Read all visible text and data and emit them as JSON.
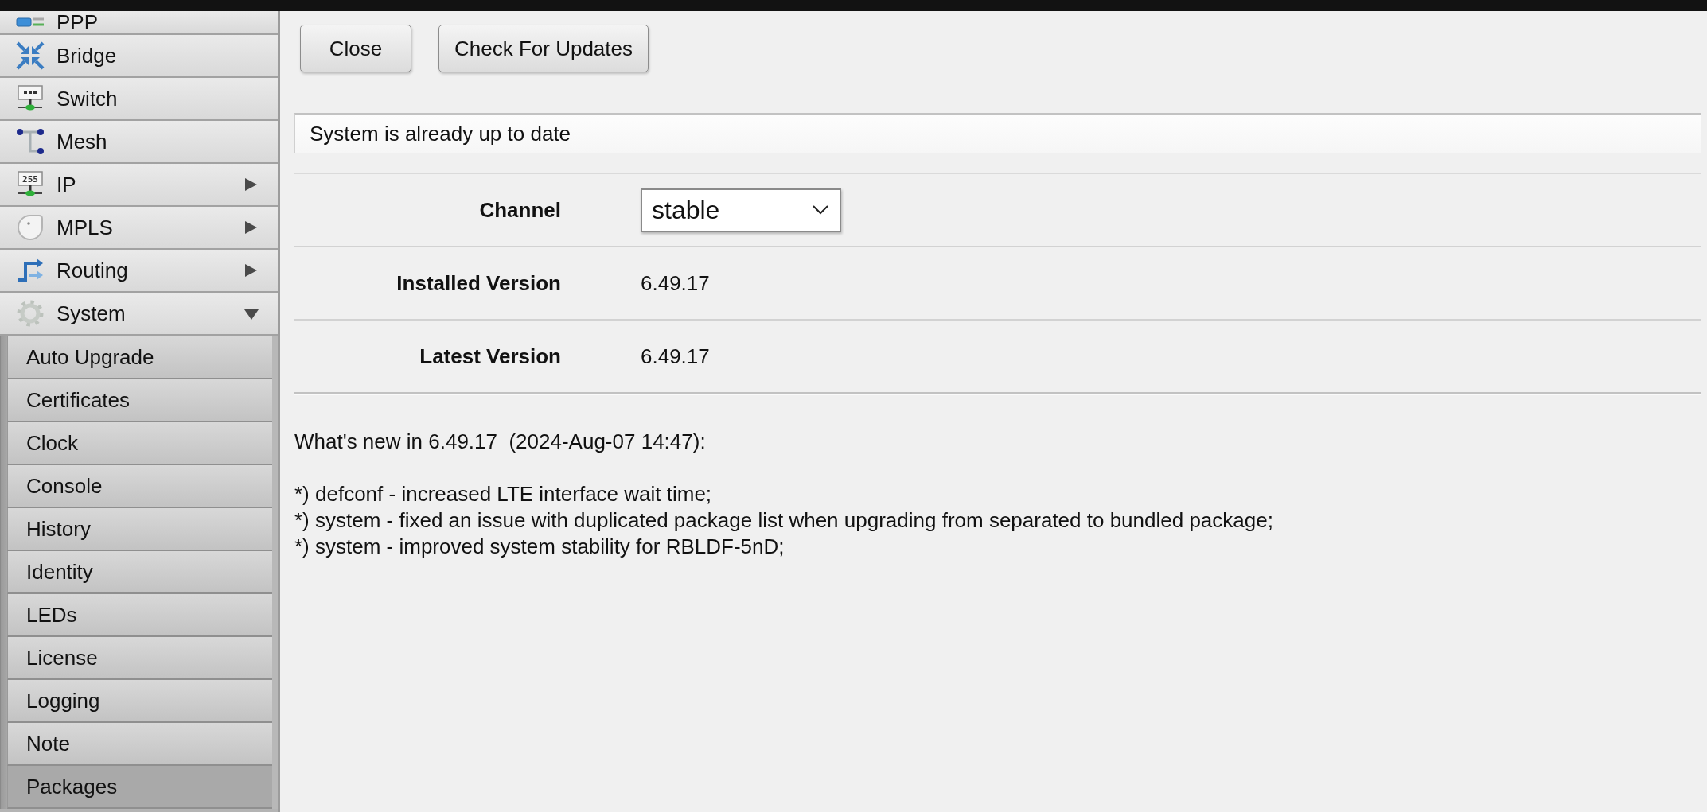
{
  "sidebar": {
    "items": [
      {
        "label": "PPP",
        "kind": "leaf"
      },
      {
        "label": "Bridge",
        "kind": "leaf"
      },
      {
        "label": "Switch",
        "kind": "leaf"
      },
      {
        "label": "Mesh",
        "kind": "leaf"
      },
      {
        "label": "IP",
        "kind": "folder",
        "expanded": false,
        "icon_text": "255"
      },
      {
        "label": "MPLS",
        "kind": "folder",
        "expanded": false
      },
      {
        "label": "Routing",
        "kind": "folder",
        "expanded": false
      },
      {
        "label": "System",
        "kind": "folder",
        "expanded": true,
        "children": [
          {
            "label": "Auto Upgrade",
            "selected": false
          },
          {
            "label": "Certificates",
            "selected": false
          },
          {
            "label": "Clock",
            "selected": false
          },
          {
            "label": "Console",
            "selected": false
          },
          {
            "label": "History",
            "selected": false
          },
          {
            "label": "Identity",
            "selected": false
          },
          {
            "label": "LEDs",
            "selected": false
          },
          {
            "label": "License",
            "selected": false
          },
          {
            "label": "Logging",
            "selected": false
          },
          {
            "label": "Note",
            "selected": false
          },
          {
            "label": "Packages",
            "selected": true
          }
        ]
      }
    ]
  },
  "toolbar": {
    "buttons": [
      "Close",
      "Check For Updates"
    ]
  },
  "status_message": "System is already up to date",
  "fields": [
    {
      "label": "Channel",
      "kind": "select",
      "value": "stable"
    },
    {
      "label": "Installed Version",
      "kind": "text",
      "value": "6.49.17"
    },
    {
      "label": "Latest Version",
      "kind": "text",
      "value": "6.49.17"
    }
  ],
  "changelog": {
    "heading": "What's new in 6.49.17  (2024-Aug-07 14:47):",
    "lines": [
      "*) defconf - increased LTE interface wait time;",
      "*) system - fixed an issue with duplicated package list when upgrading from separated to bundled package;",
      "*) system - improved system stability for RBLDF-5nD;"
    ]
  }
}
